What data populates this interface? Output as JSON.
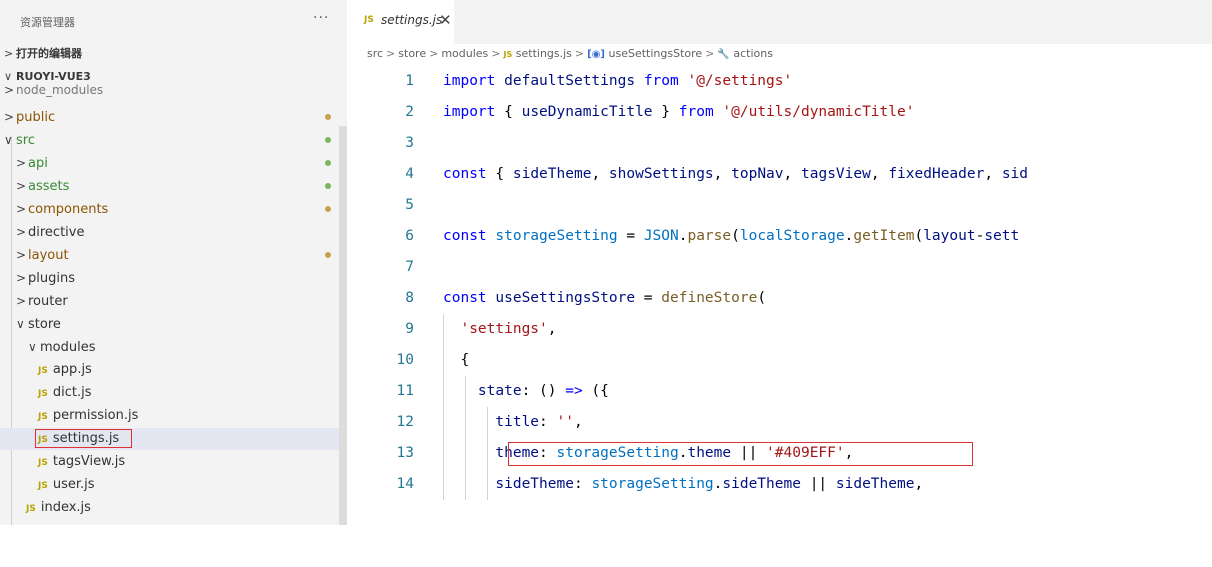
{
  "explorer": {
    "title": "资源管理器",
    "more_label": "···",
    "open_editors_label": "打开的编辑器",
    "project_label": "RUOYI-VUE3",
    "rows": [
      {
        "label": "node_modules",
        "chev": ">",
        "depth": 0
      },
      {
        "label": "public",
        "chev": ">",
        "depth": 0,
        "status": "modified"
      },
      {
        "label": "src",
        "chev": "∨",
        "depth": 0,
        "status": "untracked"
      },
      {
        "label": "api",
        "chev": ">",
        "depth": 1,
        "status": "untracked"
      },
      {
        "label": "assets",
        "chev": ">",
        "depth": 1,
        "status": "untracked"
      },
      {
        "label": "components",
        "chev": ">",
        "depth": 1,
        "status": "modified"
      },
      {
        "label": "directive",
        "chev": ">",
        "depth": 1
      },
      {
        "label": "layout",
        "chev": ">",
        "depth": 1,
        "status": "modified"
      },
      {
        "label": "plugins",
        "chev": ">",
        "depth": 1
      },
      {
        "label": "router",
        "chev": ">",
        "depth": 1
      },
      {
        "label": "store",
        "chev": "∨",
        "depth": 1
      },
      {
        "label": "modules",
        "chev": "∨",
        "depth": 2
      },
      {
        "label": "app.js",
        "icon": "JS",
        "depth": 2
      },
      {
        "label": "dict.js",
        "icon": "JS",
        "depth": 2
      },
      {
        "label": "permission.js",
        "icon": "JS",
        "depth": 2
      },
      {
        "label": "settings.js",
        "icon": "JS",
        "depth": 2,
        "selected": true
      },
      {
        "label": "tagsView.js",
        "icon": "JS",
        "depth": 2
      },
      {
        "label": "user.js",
        "icon": "JS",
        "depth": 2
      },
      {
        "label": "index.js",
        "icon": "JS",
        "depth": 1
      }
    ]
  },
  "tab": {
    "icon": "JS",
    "name": "settings.js",
    "close": "✕"
  },
  "breadcrumb": {
    "src": "src",
    "store": "store",
    "modules": "modules",
    "js_icon": "JS",
    "file": "settings.js",
    "store_icon": "[◉]",
    "store_name": "useSettingsStore",
    "actions_icon": "🔧",
    "actions": "actions"
  },
  "code": [
    "import defaultSettings from '@/settings'",
    "import { useDynamicTitle } from '@/utils/dynamicTitle'",
    "",
    "const { sideTheme, showSettings, topNav, tagsView, fixedHeader, sid",
    "",
    "const storageSetting = JSON.parse(localStorage.getItem('layout-sett",
    "",
    "const useSettingsStore = defineStore(",
    "  'settings',",
    "  {",
    "    state: () => ({",
    "      title: '',",
    "      theme: storageSetting.theme || '#409EFF',",
    "      sideTheme: storageSetting.sideTheme || sideTheme,"
  ],
  "line_numbers": [
    "1",
    "2",
    "3",
    "4",
    "5",
    "6",
    "7",
    "8",
    "9",
    "10",
    "11",
    "12",
    "13",
    "14"
  ],
  "colors": {
    "highlight_box": "#e03131",
    "keyword": "#0000ff",
    "string": "#a31515",
    "line_number": "#237893"
  }
}
